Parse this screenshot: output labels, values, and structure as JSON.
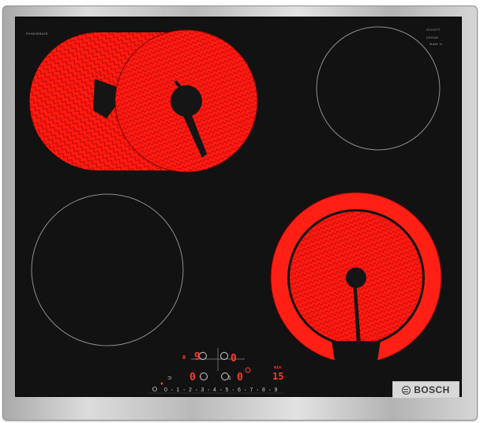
{
  "product": {
    "brand": "BOSCH",
    "top_marking_left": "PKN645BA2E",
    "top_marking_right_1": "SCHOTT",
    "top_marking_right_2": "CERAN",
    "top_marking_right_3": "Made in"
  },
  "burners": [
    {
      "id": "front-left",
      "state": "off"
    },
    {
      "id": "rear-left",
      "state": "on",
      "type": "dual-extended"
    },
    {
      "id": "rear-right",
      "state": "off"
    },
    {
      "id": "front-right",
      "state": "on",
      "type": "dual-circuit"
    }
  ],
  "controls": {
    "left_zone_top_level": "9",
    "left_zone_bottom_level": "0",
    "right_zone_top_level": "0",
    "right_zone_bottom_level": "0",
    "timer_value": "15",
    "slider_scale": [
      "0",
      "1",
      "2",
      "3",
      "4",
      "5",
      "6",
      "7",
      "8",
      "9"
    ],
    "min_label": "min"
  },
  "colors": {
    "glass": "#121212",
    "heat": "#ff1a12",
    "display": "#ff3a2a"
  }
}
